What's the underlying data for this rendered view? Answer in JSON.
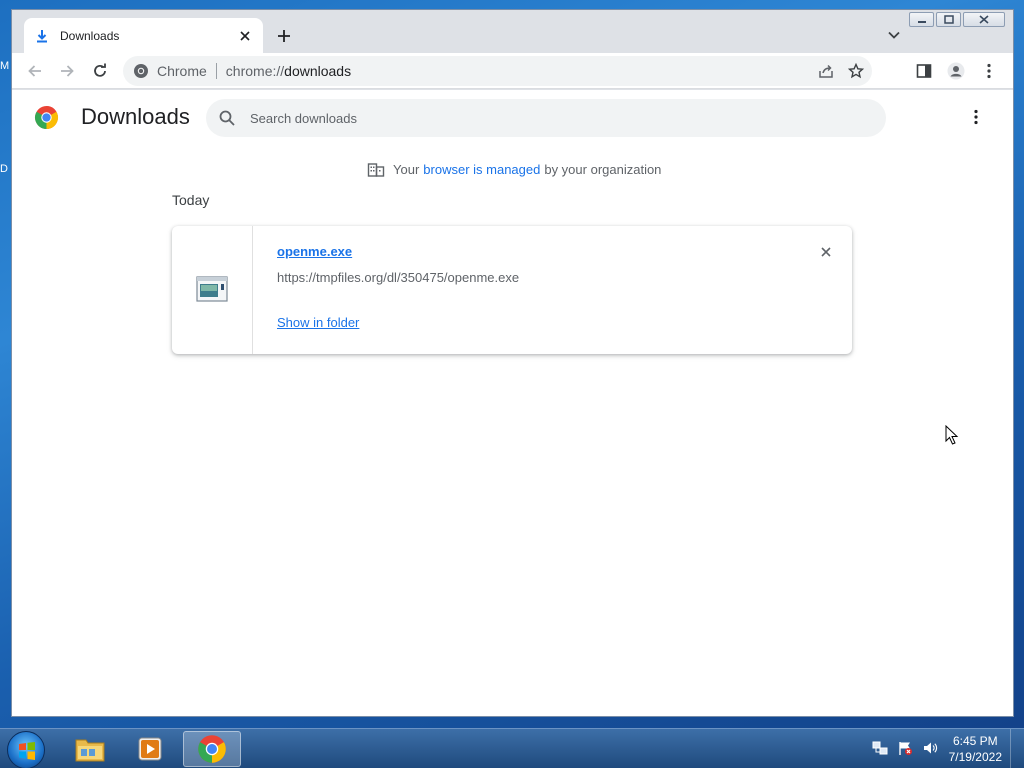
{
  "desktop": {
    "edge_letter_1": "M",
    "edge_letter_2": "D"
  },
  "browser": {
    "tab_title": "Downloads",
    "omnibox_label": "Chrome",
    "url_scheme": "chrome://",
    "url_host": "downloads"
  },
  "page": {
    "title": "Downloads",
    "search_placeholder": "Search downloads",
    "managed_prefix": "Your",
    "managed_link": "browser is managed",
    "managed_suffix": "by your organization",
    "section_label": "Today",
    "download": {
      "file_name": "openme.exe",
      "url": "https://tmpfiles.org/dl/350475/openme.exe",
      "action": "Show in folder"
    }
  },
  "taskbar": {
    "time": "6:45 PM",
    "date": "7/19/2022"
  },
  "colors": {
    "accent": "#1a73e8",
    "title_text": "#202124",
    "secondary_text": "#5f6368"
  }
}
